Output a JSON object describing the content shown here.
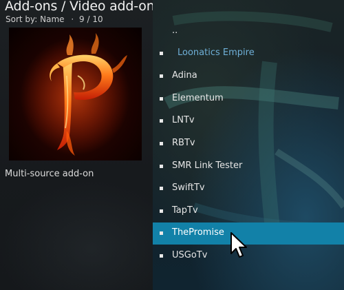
{
  "header": {
    "title": "Add-ons / Video add-ons",
    "sort_by": "Sort by: Name",
    "separator": "·",
    "position": "9 / 10"
  },
  "addon": {
    "description": "Multi-source add-on",
    "thumbnail_icon": "flaming-letter-p-icon"
  },
  "list": {
    "items": [
      {
        "label": "..",
        "bullet": false
      },
      {
        "label": "Loonatics Empire",
        "bullet": true,
        "style": "highlight-text"
      },
      {
        "label": "Adina",
        "bullet": true
      },
      {
        "label": "Elementum",
        "bullet": true
      },
      {
        "label": "LNTv",
        "bullet": true
      },
      {
        "label": "RBTv",
        "bullet": true
      },
      {
        "label": "SMR Link Tester",
        "bullet": true
      },
      {
        "label": "SwiftTv",
        "bullet": true
      },
      {
        "label": "TapTv",
        "bullet": true
      },
      {
        "label": "ThePromise",
        "bullet": true,
        "selected": true
      },
      {
        "label": "USGoTv",
        "bullet": true
      }
    ]
  },
  "colors": {
    "selection": "#1281a8",
    "highlight_text": "#6fb0d8"
  },
  "cursor_icon": "mouse-pointer-icon"
}
